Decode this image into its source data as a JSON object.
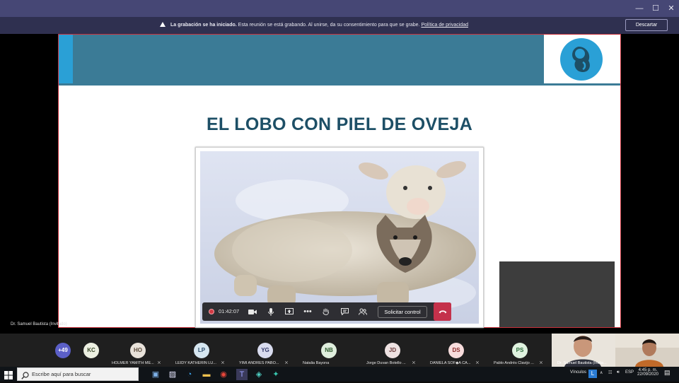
{
  "window": {
    "minimize_glyph": "—",
    "maximize_glyph": "☐",
    "close_glyph": "✕"
  },
  "recording_banner": {
    "bold": "La grabación se ha iniciado.",
    "text": " Esta reunión se está grabando. Al unirse, da su consentimiento para que se grabe. ",
    "link": "Política de privacidad",
    "dismiss_label": "Descartar"
  },
  "slide": {
    "title": "EL LOBO CON PIEL DE OVEJA",
    "logo_icon": "fetus-logo-icon",
    "colors": {
      "band": "#3b7b96",
      "accent": "#2aa0d6",
      "title": "#1d4f66",
      "border": "#c8303a"
    }
  },
  "controls": {
    "timer": "01:42:07",
    "request_control_label": "Solicitar control",
    "more_glyph": "•••"
  },
  "presenter_label": "Dr. Samuel Bautista (Invitado)",
  "participants": {
    "overflow": "+49",
    "list": [
      {
        "initials": "KC",
        "name": "",
        "bg": "#ecefe1",
        "fg": "#3a4a2a"
      },
      {
        "initials": "HO",
        "name": "HOLMER YAMITH ME...",
        "bg": "#e8e2da",
        "fg": "#5a4a3a"
      },
      {
        "initials": "LP",
        "name": "LEIDY KATHERIN LU...",
        "bg": "#d6e6f0",
        "fg": "#2a4a6a"
      },
      {
        "initials": "YG",
        "name": "YIMI ANDRES PABO...",
        "bg": "#d9dcef",
        "fg": "#343a6a"
      },
      {
        "initials": "NB",
        "name": "Natalia Bayona",
        "bg": "#dfeedd",
        "fg": "#2e5a2e"
      },
      {
        "initials": "JD",
        "name": "Jorge Duvan Botello ...",
        "bg": "#eee2e2",
        "fg": "#6a3a3a"
      },
      {
        "initials": "DS",
        "name": "DANIELA SOF◆A CA...",
        "bg": "#f7dcdc",
        "fg": "#8a2a2a"
      },
      {
        "initials": "PS",
        "name": "Pablo Andrés Clavijo ...",
        "bg": "#dff2df",
        "fg": "#2a6a3a"
      }
    ],
    "video_tile_name": "Dr. Samuel Bautista (Invita..."
  },
  "taskbar": {
    "search_placeholder": "Escribe aquí para buscar",
    "links_label": "Vínculos",
    "lang": "ESP",
    "time": "4:45 p. m.",
    "date": "22/09/2020"
  }
}
